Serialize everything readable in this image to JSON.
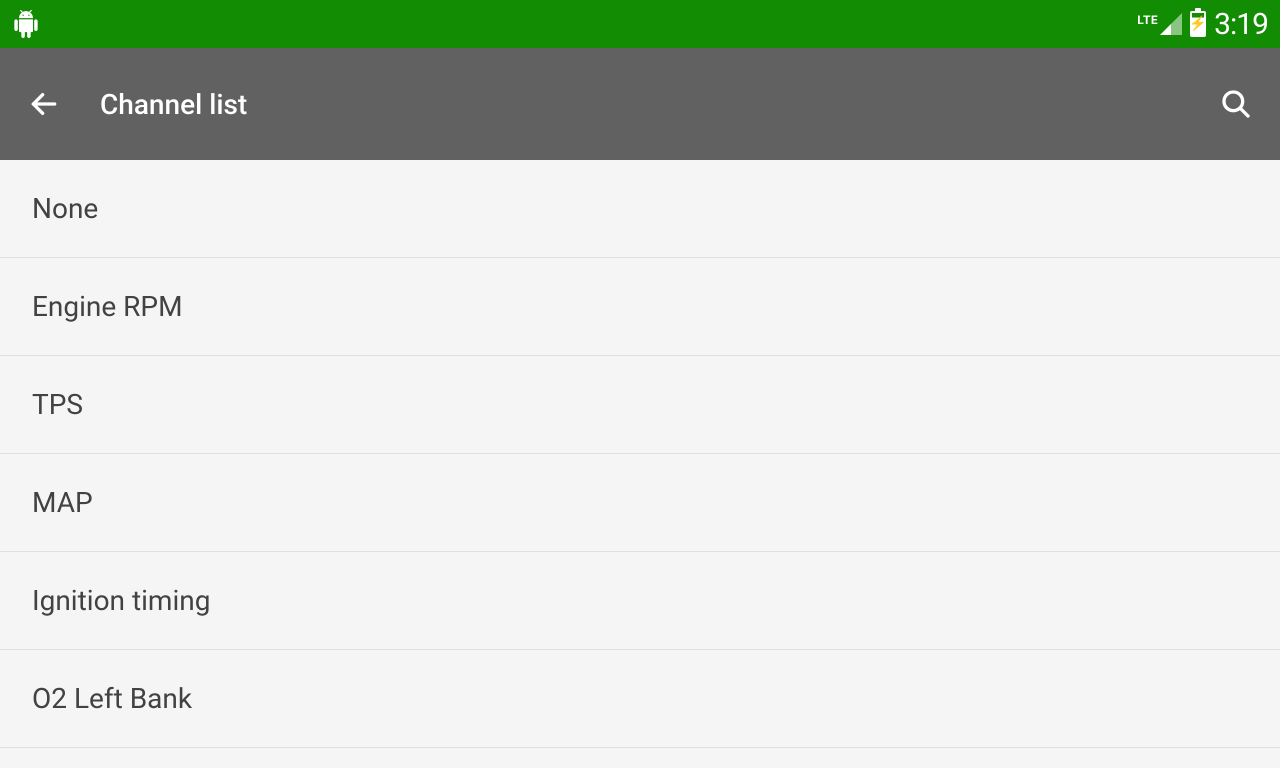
{
  "status_bar": {
    "network_label": "LTE",
    "clock": "3:19"
  },
  "app_bar": {
    "title": "Channel list"
  },
  "list": {
    "items": [
      {
        "label": "None"
      },
      {
        "label": "Engine RPM"
      },
      {
        "label": "TPS"
      },
      {
        "label": "MAP"
      },
      {
        "label": "Ignition timing"
      },
      {
        "label": "O2 Left Bank"
      }
    ]
  }
}
